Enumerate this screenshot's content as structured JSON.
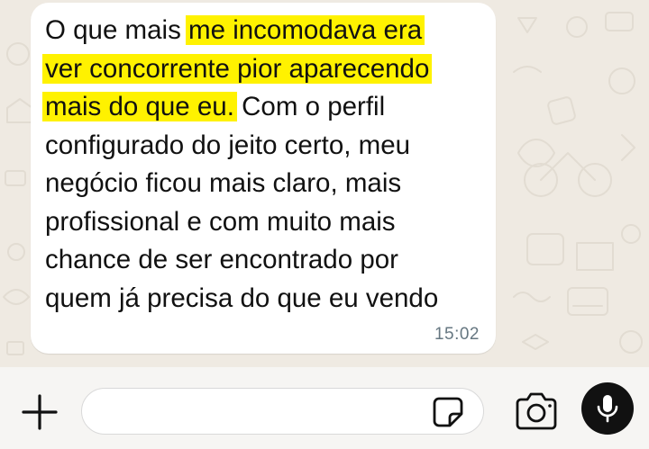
{
  "chat": {
    "message": {
      "lines": [
        [
          {
            "text": "O que mais ",
            "hl": false
          },
          {
            "text": "me incomodava era",
            "hl": true
          }
        ],
        [
          {
            "text": "ver concorrente pior aparecendo",
            "hl": true
          }
        ],
        [
          {
            "text": "mais do que eu.",
            "hl": true
          },
          {
            "text": " Com o perfil",
            "hl": false
          }
        ],
        [
          {
            "text": "configurado do jeito certo, meu",
            "hl": false
          }
        ],
        [
          {
            "text": "negócio ficou mais claro, mais",
            "hl": false
          }
        ],
        [
          {
            "text": "profissional e com muito mais",
            "hl": false
          }
        ],
        [
          {
            "text": "chance de ser encontrado por",
            "hl": false
          }
        ],
        [
          {
            "text": "quem já precisa do que eu vendo",
            "hl": false
          }
        ]
      ],
      "time": "15:02"
    }
  },
  "composer": {
    "input_value": "",
    "icons": {
      "attach": "plus-icon",
      "sticker": "sticker-icon",
      "camera": "camera-icon",
      "voice": "microphone-icon"
    }
  },
  "colors": {
    "chat_background": "#efeae2",
    "bubble": "#ffffff",
    "highlight": "#fff200",
    "timestamp": "#667781",
    "mic_button": "#111111"
  }
}
